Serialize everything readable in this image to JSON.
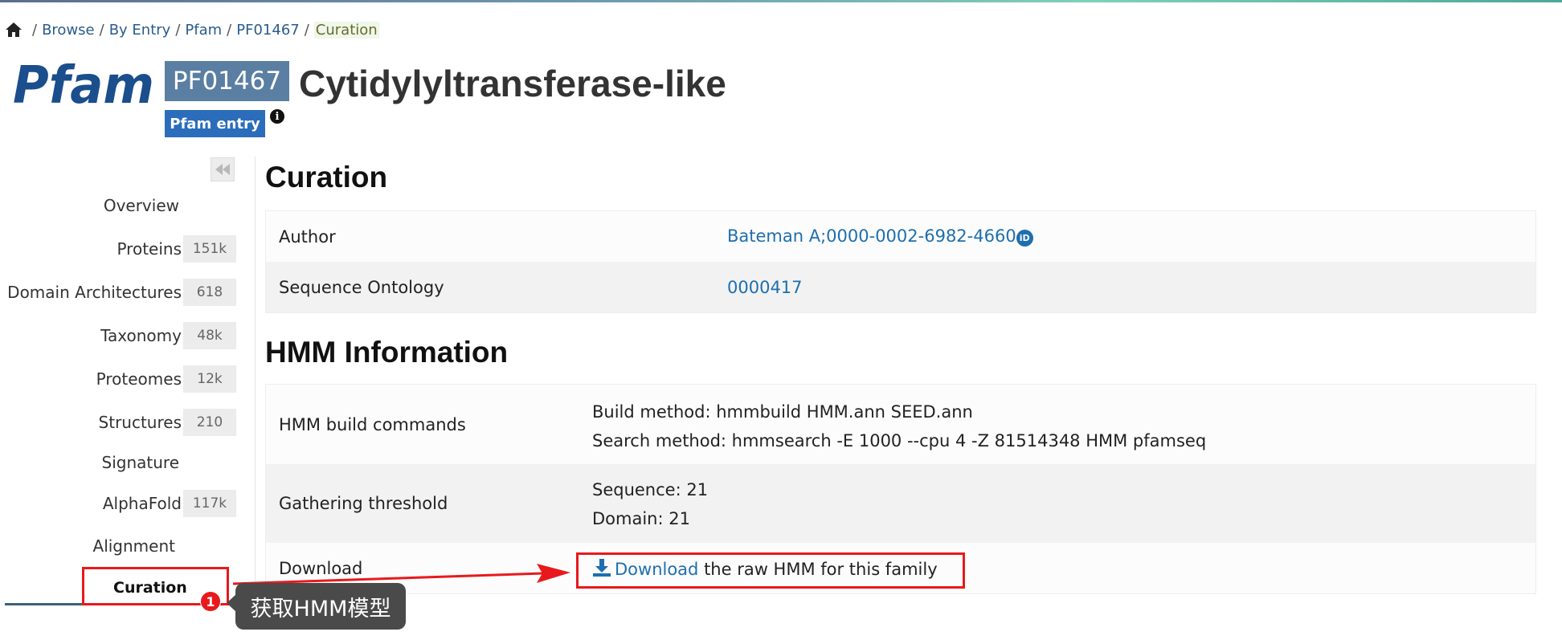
{
  "breadcrumb": {
    "items": [
      "Browse",
      "By Entry",
      "Pfam",
      "PF01467"
    ],
    "current": "Curation",
    "separator": "/"
  },
  "header": {
    "logo_text": "Pfam",
    "accession": "PF01467",
    "title": "Cytidylyltransferase-like",
    "badge": "Pfam entry",
    "info_glyph": "i"
  },
  "sidebar": {
    "items": [
      {
        "label": "Overview",
        "count": ""
      },
      {
        "label": "Proteins",
        "count": "151k"
      },
      {
        "label": "Domain Architectures",
        "count": "618"
      },
      {
        "label": "Taxonomy",
        "count": "48k"
      },
      {
        "label": "Proteomes",
        "count": "12k"
      },
      {
        "label": "Structures",
        "count": "210"
      },
      {
        "label": "Signature",
        "count": ""
      },
      {
        "label": "AlphaFold",
        "count": "117k"
      },
      {
        "label": "Alignment",
        "count": ""
      },
      {
        "label": "Curation",
        "count": ""
      }
    ],
    "active": "Curation"
  },
  "curation": {
    "heading": "Curation",
    "author_label": "Author",
    "author_value": "Bateman A;0000-0002-6982-4660",
    "orcid_glyph": "iD",
    "so_label": "Sequence Ontology",
    "so_value": "0000417"
  },
  "hmm": {
    "heading": "HMM Information",
    "build_label": "HMM build commands",
    "build_method": "Build method: hmmbuild HMM.ann SEED.ann",
    "search_method": "Search method: hmmsearch -E 1000 --cpu 4 -Z 81514348 HMM pfamseq",
    "threshold_label": "Gathering threshold",
    "sequence": "Sequence: 21",
    "domain": "Domain: 21",
    "download_label": "Download",
    "download_link": "Download",
    "download_text": " the raw HMM for this family"
  },
  "annotation": {
    "step": "1",
    "tooltip": "获取HMM模型",
    "color": "#e8191c"
  },
  "colors": {
    "accession_bg": "#5b7ea3",
    "badge_bg": "#2b6dbb",
    "link": "#1e6fae",
    "logo": "#1a4e8c"
  }
}
